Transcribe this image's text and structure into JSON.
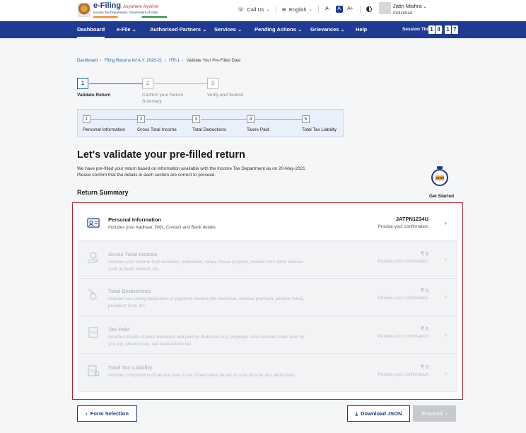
{
  "header": {
    "logo_main": "e-Filing",
    "logo_tagline": "Anywhere Anytime",
    "logo_sub": "Income Tax Department, Government of India",
    "call_us": "Call Us",
    "language": "English",
    "font_controls": [
      "A-",
      "A",
      "A+"
    ],
    "user_name": "Jatin Mishra",
    "user_role": "Individual"
  },
  "nav": {
    "items": [
      "Dashboard",
      "e-File",
      "Authorised Partners",
      "Services",
      "Pending Actions",
      "Grievances",
      "Help"
    ],
    "session_label": "Session Time",
    "session_digits": [
      "1",
      "4",
      ":",
      "1",
      "7"
    ]
  },
  "breadcrumb": [
    "Dashboard",
    "Filing Returns for A.Y. 2020-21",
    "ITR-1",
    "Validate Your Pre-Filled Data"
  ],
  "steps": [
    {
      "num": "1",
      "label": "Validate Return"
    },
    {
      "num": "2",
      "label": "Confirm your Return Summary"
    },
    {
      "num": "3",
      "label": "Verify and Submit"
    }
  ],
  "substeps": [
    {
      "num": "1",
      "label": "Personal Information"
    },
    {
      "num": "2",
      "label": "Gross Total Income"
    },
    {
      "num": "3",
      "label": "Total Deductions"
    },
    {
      "num": "4",
      "label": "Taxes Paid"
    },
    {
      "num": "5",
      "label": "Total Tax Liability"
    }
  ],
  "main": {
    "title": "Let's validate your pre-filled return",
    "desc_line1": "We have pre-filled your return based on information available with the Income Tax Department as on  20-May-2021",
    "desc_line2": "Please confirm that the details in each section are correct to proceed.",
    "section_title": "Return Summary",
    "timer_text": "00:00",
    "get_started": "Get Started"
  },
  "rows": [
    {
      "title": "Personal Information",
      "desc": "Includes your Aadhaar, PAN, Contact and Bank details",
      "value": "JATPN1234U",
      "confirm": "Provide your confirmation",
      "icon": "personal-info-icon"
    },
    {
      "title": "Gross Total Income",
      "desc": "Includes your income from business, profession, salary, house property, income from other sources such as bank interest, etc.",
      "value": "₹ 0",
      "confirm": "Provide your confirmation",
      "icon": "income-icon"
    },
    {
      "title": "Total Deductions",
      "desc": "Includes tax saving deductions or payment towards life insurance, medical premium, pension funds, provident fund, etc.",
      "value": "₹ 0",
      "confirm": "Provide your confirmation",
      "icon": "deductions-icon"
    },
    {
      "title": "Tax Paid",
      "desc": "Includes details of taxes deducted and paid by deductors e.g. employer. Also includes taxes paid by you e.g. advance tax, self assessment tax.",
      "value": "₹ 0",
      "confirm": "Provide your confirmation",
      "icon": "tax-paid-icon"
    },
    {
      "title": "Total Tax Liability",
      "desc": "Includes computation of tax you owe to the Government based on your income and deductions",
      "value": "₹ 0",
      "confirm": "Provide your confirmation",
      "icon": "tax-liability-icon"
    }
  ],
  "footer": {
    "form_selection": "Form Selection",
    "download_json": "Download JSON",
    "proceed": "Proceed"
  },
  "colors": {
    "nav_bg": "#1f3a93",
    "accent": "#1b5fb0",
    "highlight_border": "#b3262b"
  }
}
